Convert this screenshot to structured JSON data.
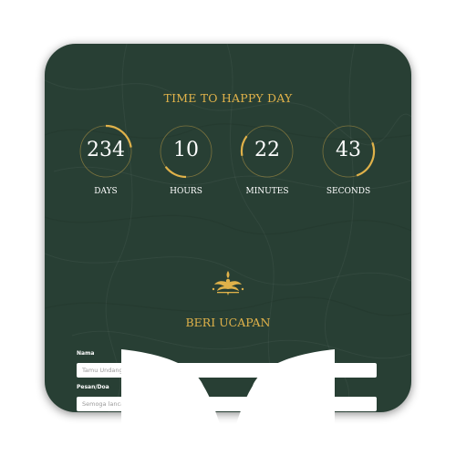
{
  "countdown": {
    "title": "TIME TO HAPPY DAY",
    "units": [
      {
        "value": "234",
        "label": "DAYS",
        "progress": 0.64
      },
      {
        "value": "10",
        "label": "HOURS",
        "progress": 0.42
      },
      {
        "value": "22",
        "label": "MINUTES",
        "progress": 0.37
      },
      {
        "value": "43",
        "label": "SECONDS",
        "progress": 0.72
      }
    ]
  },
  "wishes": {
    "title": "BERI UCAPAN",
    "name_label": "Nama",
    "name_placeholder": "Tamu Undangan",
    "message_label": "Pesan/Doa",
    "message_placeholder": "Semoga lancar acara nya, Ha"
  },
  "colors": {
    "background": "#283f34",
    "accent": "#e0b24a",
    "text": "#ffffff"
  },
  "icons": [
    "floral-ornament-icon"
  ]
}
